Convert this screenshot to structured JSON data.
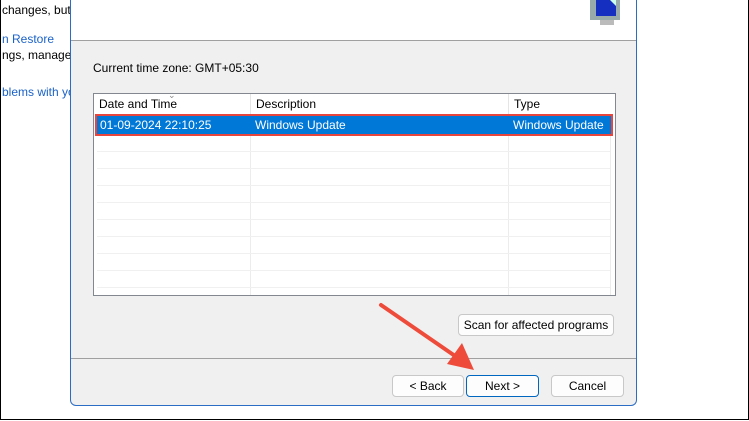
{
  "background": {
    "lines": [
      "changes, but",
      "n Restore",
      "ngs, manage",
      "blems with yo"
    ]
  },
  "dialog": {
    "timezone": "Current time zone: GMT+05:30",
    "columns": [
      "Date and Time",
      "Description",
      "Type"
    ],
    "rows": [
      {
        "date": "01-09-2024 22:10:25",
        "description": "Windows Update",
        "type": "Windows Update",
        "selected": true
      }
    ],
    "scan_label": "Scan for affected programs",
    "back_label": "< Back",
    "next_label": "Next >",
    "cancel_label": "Cancel"
  },
  "colors": {
    "selection": "#0078d7",
    "highlight": "#e8453c",
    "arrow": "#ee4b3b",
    "link": "#1a62c9"
  }
}
